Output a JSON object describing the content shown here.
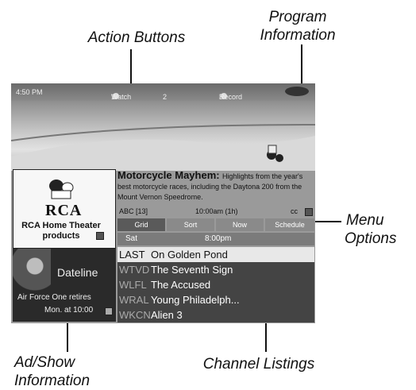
{
  "callouts": {
    "program_information": [
      "Program",
      "Information"
    ],
    "action_buttons": "Action Buttons",
    "menu_options": [
      "Menu",
      "Options"
    ],
    "ad_show_information": [
      "Ad/Show",
      "Information"
    ],
    "channel_listings": "Channel Listings"
  },
  "topbar": {
    "time": "4:50 PM",
    "btn1_num": "1",
    "btn1_label": "Watch",
    "btn2_num": "2",
    "btn3_num": "3",
    "btn3_label": "Record"
  },
  "ad": {
    "brand": "RCA",
    "text": "RCA Home Theater products"
  },
  "show": {
    "title": "Dateline",
    "subtitle": "Air Force One retires",
    "time": "Mon. at 10:00"
  },
  "program": {
    "title": "Motorcycle Mayhem:",
    "description": "Highlights from the year's best motorcycle races, including the Daytona 200 from the Mount Vernon Speedrome.",
    "channel": "ABC [13]",
    "time": "10:00am (1h)",
    "extra": "cc"
  },
  "menu": [
    "Grid",
    "Sort",
    "Now",
    "Schedule"
  ],
  "listing_header": {
    "day": "Sat",
    "time": "8:00pm"
  },
  "listings": [
    {
      "channel": "LAST",
      "program": "On Golden Pond"
    },
    {
      "channel": "WTVD",
      "program": "The Seventh Sign"
    },
    {
      "channel": "WLFL",
      "program": "The Accused"
    },
    {
      "channel": "WRAL",
      "program": "Young Philadelph..."
    },
    {
      "channel": "WKCN",
      "program": "Alien 3"
    }
  ],
  "colors": {
    "screen_bg": "#9a9a9a",
    "listing_bg": "#444444",
    "selected_row_bg": "#e8e8e8",
    "menu_selected": "#5a5a5a"
  }
}
